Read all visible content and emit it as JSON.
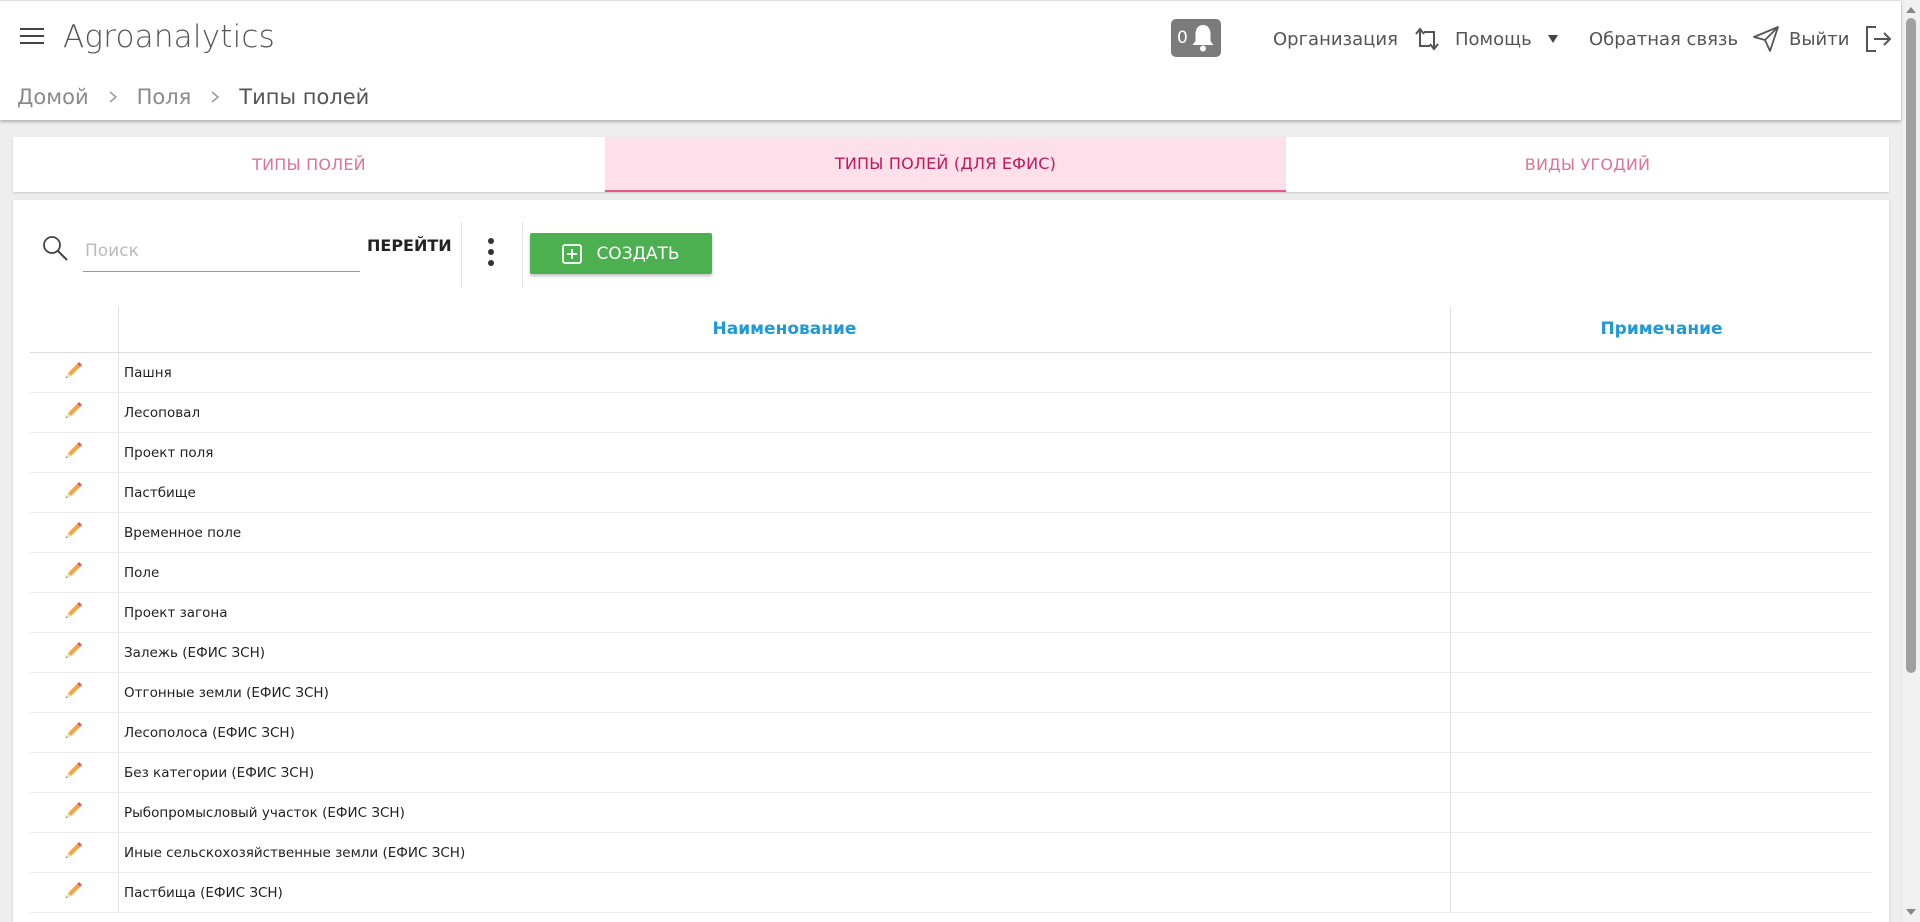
{
  "header": {
    "app_title": "Agroanalytics",
    "notifications_count": "0",
    "organization_label": "Организация",
    "help_label": "Помощь",
    "feedback_label": "Обратная связь",
    "logout_label": "Выйти"
  },
  "breadcrumb": {
    "home": "Домой",
    "fields": "Поля",
    "current": "Типы полей"
  },
  "tabs": [
    {
      "label": "Типы полей",
      "active": false
    },
    {
      "label": "Типы полей (для ЕФИС)",
      "active": true
    },
    {
      "label": "Виды угодий",
      "active": false
    }
  ],
  "toolbar": {
    "search_placeholder": "Поиск",
    "go_label": "ПЕРЕЙТИ",
    "create_label": "Создать"
  },
  "table": {
    "columns": {
      "name": "Наименование",
      "note": "Примечание"
    },
    "rows": [
      {
        "name": "Пашня",
        "note": ""
      },
      {
        "name": "Лесоповал",
        "note": ""
      },
      {
        "name": "Проект поля",
        "note": ""
      },
      {
        "name": "Пастбище",
        "note": ""
      },
      {
        "name": "Временное поле",
        "note": ""
      },
      {
        "name": "Поле",
        "note": ""
      },
      {
        "name": "Проект загона",
        "note": ""
      },
      {
        "name": "Залежь (ЕФИС ЗСН)",
        "note": ""
      },
      {
        "name": "Отгонные земли (ЕФИС ЗСН)",
        "note": ""
      },
      {
        "name": "Лесополоса (ЕФИС ЗСН)",
        "note": ""
      },
      {
        "name": "Без категории (ЕФИС ЗСН)",
        "note": ""
      },
      {
        "name": "Рыбопромысловый участок (ЕФИС ЗСН)",
        "note": ""
      },
      {
        "name": "Иные сельскохозяйственные земли (ЕФИС ЗСН)",
        "note": ""
      },
      {
        "name": "Пастбища (ЕФИС ЗСН)",
        "note": ""
      }
    ]
  },
  "colors": {
    "accent_pink": "#e07397",
    "active_tab_bg": "#fde0ea",
    "header_blue": "#1f9ad6",
    "create_green": "#4caf50",
    "pencil_orange": "#f4a640"
  }
}
